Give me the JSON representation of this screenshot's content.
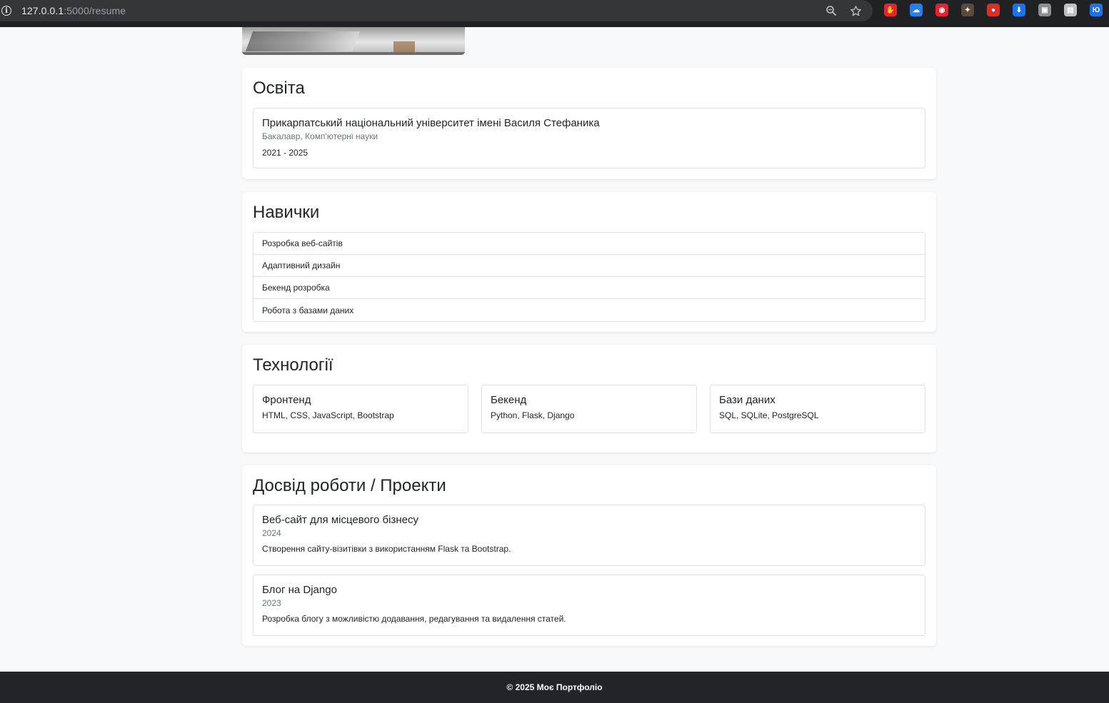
{
  "browser": {
    "url_host": "127.0.0.1",
    "url_rest": ":5000/resume",
    "extensions": [
      {
        "name": "ext-1",
        "color": "#e8222d",
        "glyph": "✋"
      },
      {
        "name": "ext-2",
        "color": "#2b7de9",
        "glyph": "☁"
      },
      {
        "name": "ext-3",
        "color": "#e8222d",
        "glyph": "◉"
      },
      {
        "name": "ext-4",
        "color": "#5a4b3c",
        "glyph": "✦"
      },
      {
        "name": "ext-5",
        "color": "#d93025",
        "glyph": "●"
      },
      {
        "name": "ext-6",
        "color": "#1a73e8",
        "glyph": "⬇"
      },
      {
        "name": "ext-7",
        "color": "#8a8d91",
        "glyph": "▣"
      },
      {
        "name": "ext-8",
        "color": "#bdc1c6",
        "glyph": "▤"
      },
      {
        "name": "ext-9",
        "color": "#1a73e8",
        "glyph": "Ю"
      }
    ]
  },
  "education": {
    "heading": "Освіта",
    "university": "Прикарпатський національний університет імені Василя Стефаника",
    "degree": "Бакалавр, Комп'ютерні науки",
    "years": "2021 - 2025"
  },
  "skills": {
    "heading": "Навички",
    "items": [
      "Розробка веб-сайтів",
      "Адаптивний дизайн",
      "Бекенд розробка",
      "Робота з базами даних"
    ]
  },
  "technologies": {
    "heading": "Технології",
    "groups": [
      {
        "title": "Фронтенд",
        "list": "HTML, CSS, JavaScript, Bootstrap"
      },
      {
        "title": "Бекенд",
        "list": "Python, Flask, Django"
      },
      {
        "title": "Бази даних",
        "list": "SQL, SQLite, PostgreSQL"
      }
    ]
  },
  "experience": {
    "heading": "Досвід роботи / Проекти",
    "projects": [
      {
        "title": "Веб-сайт для місцевого бізнесу",
        "year": "2024",
        "description": "Створення сайту-візитівки з використанням Flask та Bootstrap."
      },
      {
        "title": "Блог на Django",
        "year": "2023",
        "description": "Розробка блогу з можливістю додавання, редагування та видалення статей."
      }
    ]
  },
  "footer": {
    "text": "© 2025 Моє Портфоліо"
  }
}
